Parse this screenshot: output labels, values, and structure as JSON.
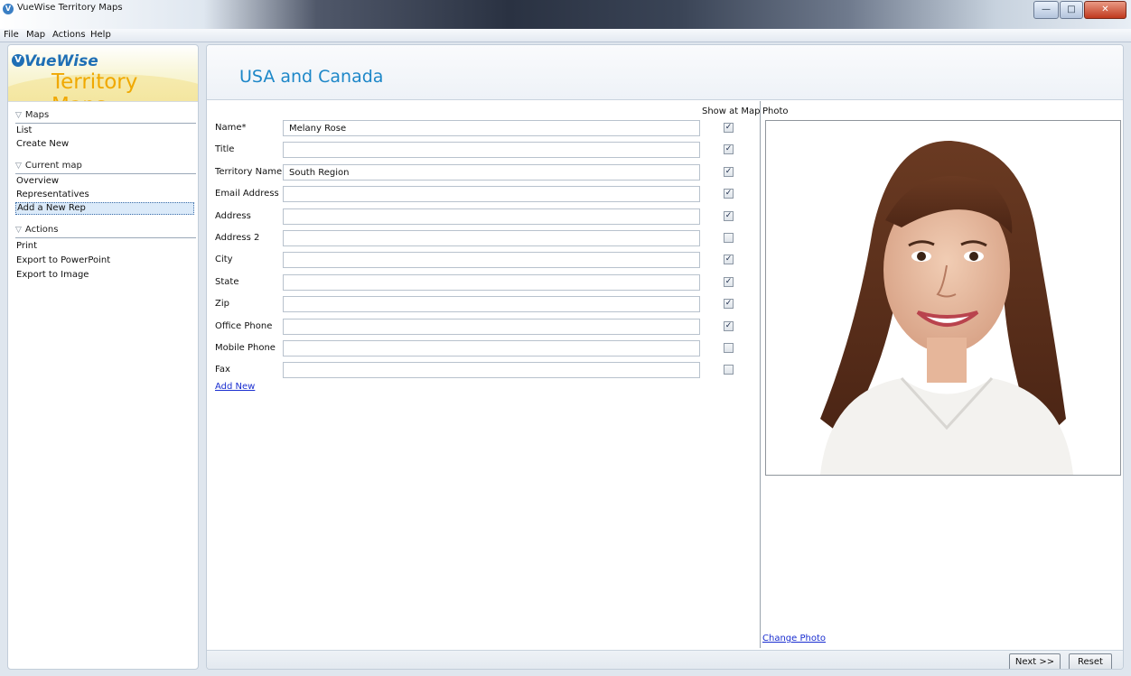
{
  "window": {
    "title": "VueWise Territory Maps",
    "app_icon": "V",
    "minimize": "—",
    "maximize": "□",
    "close": "✕"
  },
  "menu": [
    "File",
    "Map",
    "Actions",
    "Help"
  ],
  "logo": {
    "brand": "VueWise",
    "product": "Territory Maps",
    "mark": "V"
  },
  "sidebar": {
    "sections": [
      {
        "title": "Maps",
        "items": [
          "List",
          "Create New"
        ]
      },
      {
        "title": "Current map",
        "items": [
          "Overview",
          "Representatives",
          "Add a New Rep"
        ]
      },
      {
        "title": "Actions",
        "items": [
          "Print",
          "Export to PowerPoint",
          "Export to Image"
        ]
      }
    ],
    "selected": "Add a New Rep",
    "toggle_glyph": "▽"
  },
  "main": {
    "title": "USA and Canada",
    "show_at_map_header": "Show at Map",
    "photo_header": "Photo",
    "fields": [
      {
        "label": "Name*",
        "value": "Melany Rose",
        "show": true
      },
      {
        "label": "Title",
        "value": "",
        "show": true
      },
      {
        "label": "Territory Name",
        "value": "South Region",
        "show": true
      },
      {
        "label": "Email Address",
        "value": "",
        "show": true
      },
      {
        "label": "Address",
        "value": "",
        "show": true
      },
      {
        "label": "Address 2",
        "value": "",
        "show": false
      },
      {
        "label": "City",
        "value": "",
        "show": true
      },
      {
        "label": "State",
        "value": "",
        "show": true
      },
      {
        "label": "Zip",
        "value": "",
        "show": true
      },
      {
        "label": "Office Phone",
        "value": "",
        "show": true
      },
      {
        "label": "Mobile Phone",
        "value": "",
        "show": false
      },
      {
        "label": "Fax",
        "value": "",
        "show": false
      }
    ],
    "add_new": "Add New",
    "change_photo": "Change Photo",
    "check_glyph": "✓"
  },
  "footer": {
    "next": "Next >>",
    "reset": "Reset"
  },
  "colors": {
    "title_blue": "#1d87c8",
    "logo_orange": "#f0a800",
    "logo_blue": "#1f6fb5",
    "link": "#1a2ed0"
  }
}
